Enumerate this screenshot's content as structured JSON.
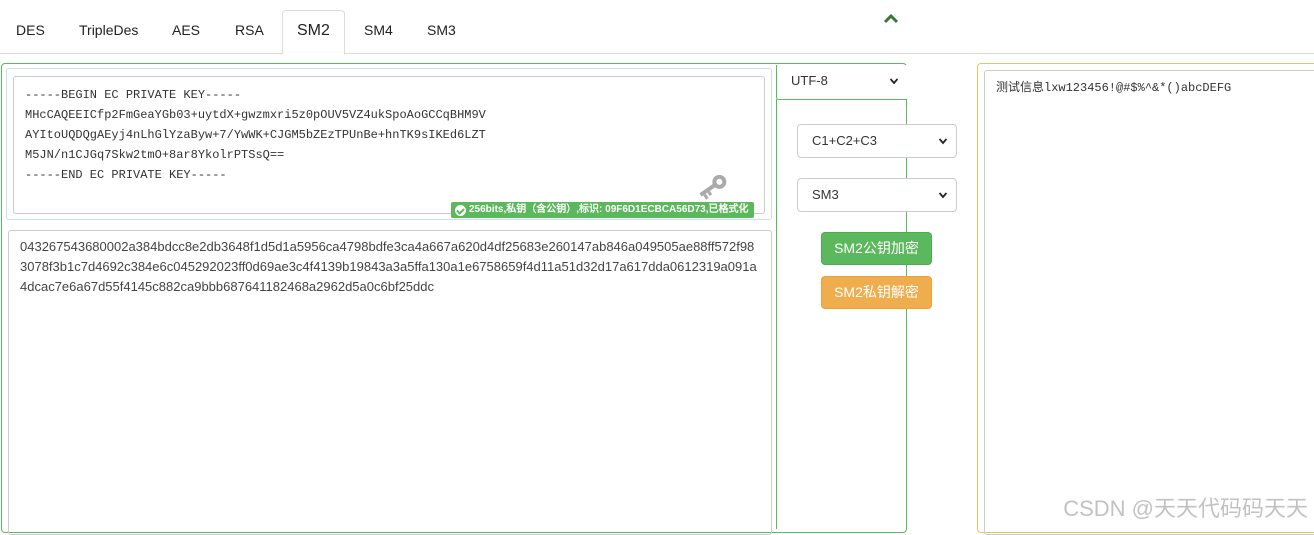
{
  "tabs": [
    "DES",
    "TripleDes",
    "AES",
    "RSA",
    "SM2",
    "SM4",
    "SM3"
  ],
  "active_tab": "SM2",
  "key": {
    "text": "-----BEGIN EC PRIVATE KEY-----\nMHcCAQEEICfp2FmGeaYGb03+uytdX+gwzmxri5z0pOUV5VZ4ukSpoAoGCCqBHM9V\nAYItoUQDQgAEyj4nLhGlYzaByw+7/YwWK+CJGM5bZEzTPUnBe+hnTK9sIKEd6LZT\nM5JN/n1CJGq7Skw2tmO+8ar8YkolrPTSsQ==\n-----END EC PRIVATE KEY-----",
    "badge": "256bits,私钥（含公钥）,标识: 09F6D1ECBCA56D73,已格式化"
  },
  "ciphertext": "043267543680002a384bdcc8e2db3648f1d5d1a5956ca4798bdfe3ca4a667a620d4df25683e260147ab846a049505ae88ff572f983078f3b1c7d4692c384e6c045292023ff0d69ae3c4f4139b19843a3a5ffa130a1e6758659f4d11a51d32d17a617dda0612319a091a4dcac7e6a67d55f4145c882ca9bbb687641182468a2962d5a0c6bf25ddc",
  "encoding_select": "UTF-8",
  "mode_select": "C1+C2+C3",
  "hash_select": "SM3",
  "buttons": {
    "encrypt": "SM2公钥加密",
    "decrypt": "SM2私钥解密"
  },
  "plaintext": "测试信息lxw123456!@#$%^&*()abcDEFG",
  "watermark": "CSDN @天天代码码天天",
  "colors": {
    "green": "#5cb85c",
    "orange": "#f0ad4e",
    "panel_yellow": "#e4c95a"
  },
  "icons": [
    "chevron-up-icon",
    "key-icon",
    "check-circle-icon",
    "chevron-down-icon"
  ]
}
